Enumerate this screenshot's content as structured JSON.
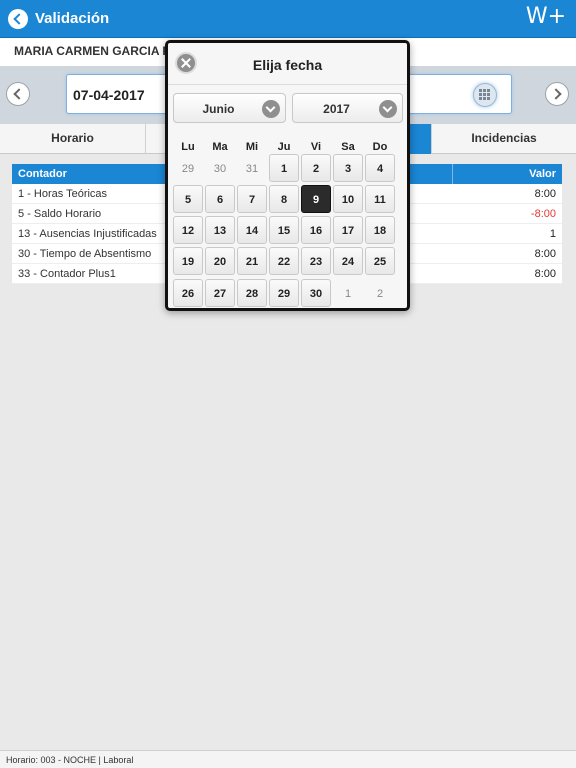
{
  "header": {
    "title": "Validación",
    "brand": "W+"
  },
  "employee": {
    "name": "MARIA CARMEN GARCIA F"
  },
  "date_bar": {
    "date": "07-04-2017"
  },
  "tabs": [
    {
      "label": "Horario"
    },
    {
      "label": ""
    },
    {
      "label": ""
    },
    {
      "label": "Incidencias"
    }
  ],
  "table": {
    "columns": {
      "counter": "Contador",
      "value": "Valor"
    },
    "rows": [
      {
        "name": "1 - Horas Teóricas",
        "value": "8:00",
        "negative": false
      },
      {
        "name": "5 - Saldo Horario",
        "value": "-8:00",
        "negative": true
      },
      {
        "name": "13 - Ausencias Injustificadas",
        "value": "1",
        "negative": false
      },
      {
        "name": "30 - Tiempo de Absentismo",
        "value": "8:00",
        "negative": false
      },
      {
        "name": "33 - Contador Plus1",
        "value": "8:00",
        "negative": false
      }
    ]
  },
  "footer": {
    "text": "Horario: 003 - NOCHE  |  Laboral"
  },
  "picker": {
    "title": "Elija fecha",
    "month": "Junio",
    "year": "2017",
    "weekdays": [
      "Lu",
      "Ma",
      "Mi",
      "Ju",
      "Vi",
      "Sa",
      "Do"
    ],
    "weeks": [
      [
        {
          "d": "29",
          "out": true
        },
        {
          "d": "30",
          "out": true
        },
        {
          "d": "31",
          "out": true
        },
        {
          "d": "1"
        },
        {
          "d": "2"
        },
        {
          "d": "3"
        },
        {
          "d": "4"
        }
      ],
      [
        {
          "d": "5"
        },
        {
          "d": "6"
        },
        {
          "d": "7"
        },
        {
          "d": "8"
        },
        {
          "d": "9",
          "selected": true
        },
        {
          "d": "10"
        },
        {
          "d": "11"
        }
      ],
      [
        {
          "d": "12"
        },
        {
          "d": "13"
        },
        {
          "d": "14"
        },
        {
          "d": "15"
        },
        {
          "d": "16"
        },
        {
          "d": "17"
        },
        {
          "d": "18"
        }
      ],
      [
        {
          "d": "19"
        },
        {
          "d": "20"
        },
        {
          "d": "21"
        },
        {
          "d": "22"
        },
        {
          "d": "23"
        },
        {
          "d": "24"
        },
        {
          "d": "25"
        }
      ],
      [
        {
          "d": "26"
        },
        {
          "d": "27"
        },
        {
          "d": "28"
        },
        {
          "d": "29"
        },
        {
          "d": "30"
        },
        {
          "d": "1",
          "out": true
        },
        {
          "d": "2",
          "out": true
        }
      ]
    ]
  },
  "icons": {
    "back": "chevron-left-icon",
    "prev": "chevron-left-icon",
    "next": "chevron-right-icon",
    "calendar": "calendar-grid-icon",
    "close": "close-icon",
    "dropdown": "chevron-down-icon"
  },
  "colors": {
    "primary": "#1a86d4",
    "negative": "#e53935",
    "selected_day": "#2b2b2b"
  }
}
